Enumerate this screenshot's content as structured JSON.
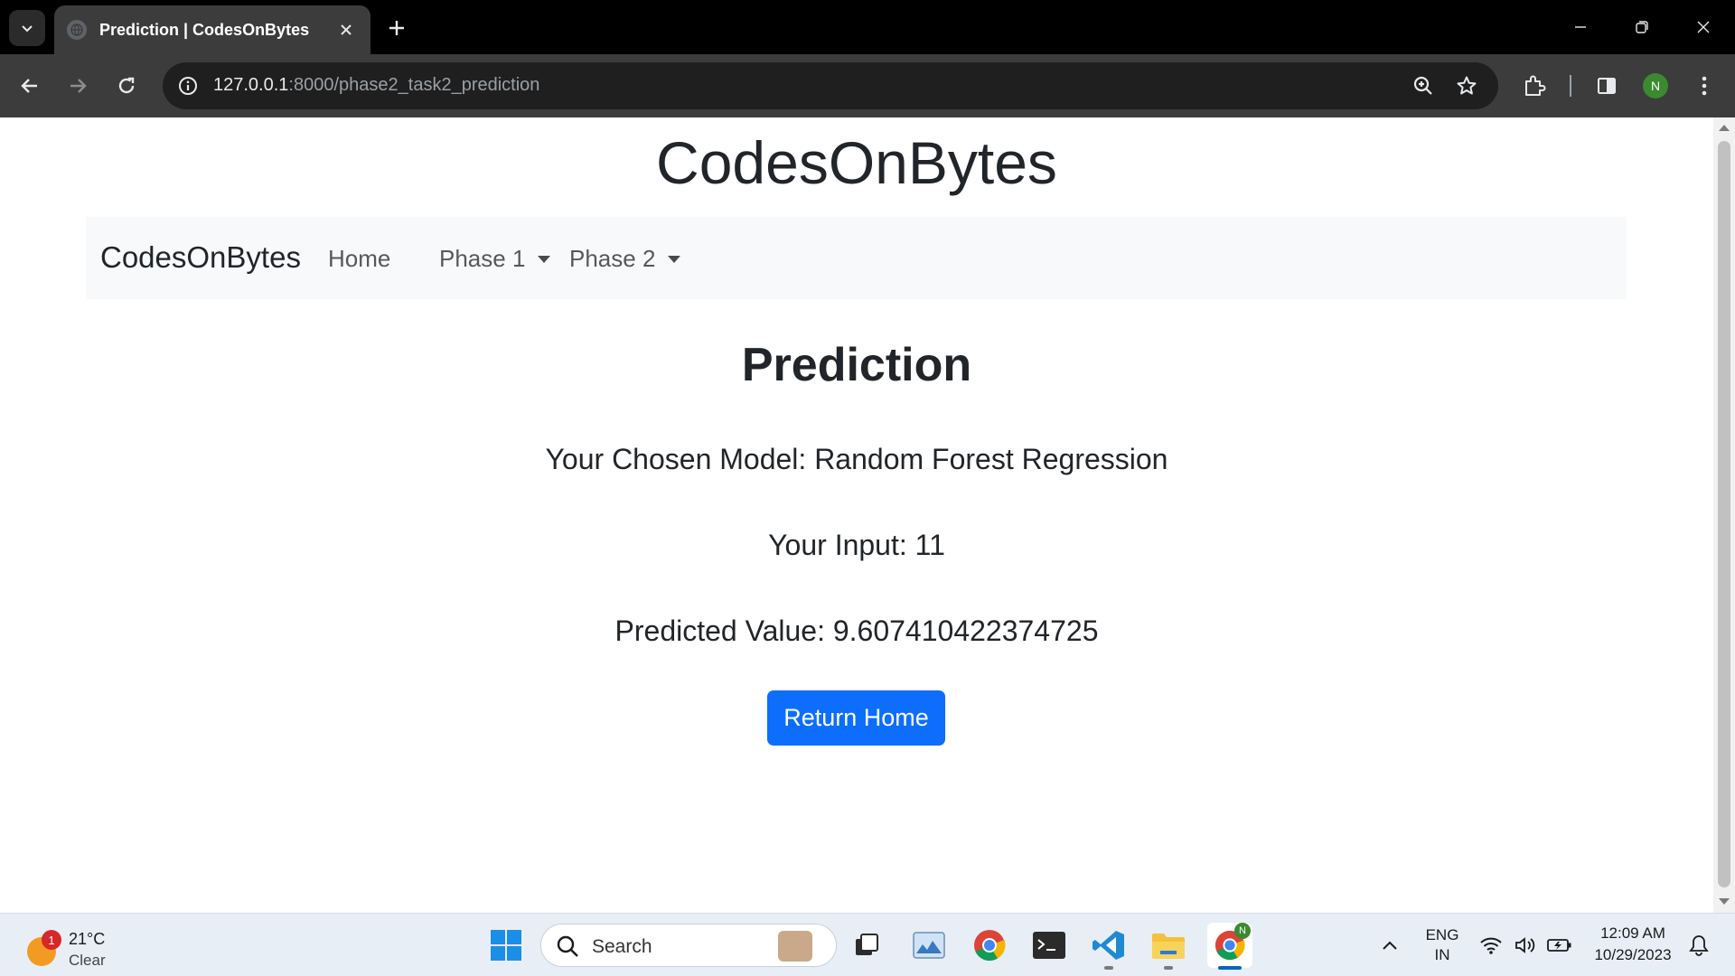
{
  "browser": {
    "tab_title": "Prediction | CodesOnBytes",
    "url_host": "127.0.0.1",
    "url_rest": ":8000/phase2_task2_prediction",
    "profile_initial": "N"
  },
  "page": {
    "site_title": "CodesOnBytes",
    "navbar": {
      "brand": "CodesOnBytes",
      "items": [
        {
          "label": "Home",
          "dropdown": false
        },
        {
          "label": "Phase 1",
          "dropdown": true
        },
        {
          "label": "Phase 2",
          "dropdown": true
        }
      ]
    },
    "heading": "Prediction",
    "model_line": "Your Chosen Model: Random Forest Regression",
    "input_line": "Your Input: 11",
    "predicted_line": "Predicted Value: 9.607410422374725",
    "button_label": "Return Home",
    "colors": {
      "primary": "#0d6efd",
      "navbar_bg": "#f8f9fa"
    }
  },
  "taskbar": {
    "weather": {
      "temp": "21°C",
      "condition": "Clear",
      "badge": "1"
    },
    "search_placeholder": "Search",
    "language_line1": "ENG",
    "language_line2": "IN",
    "time": "12:09 AM",
    "date": "10/29/2023",
    "chrome_badge": "N"
  }
}
